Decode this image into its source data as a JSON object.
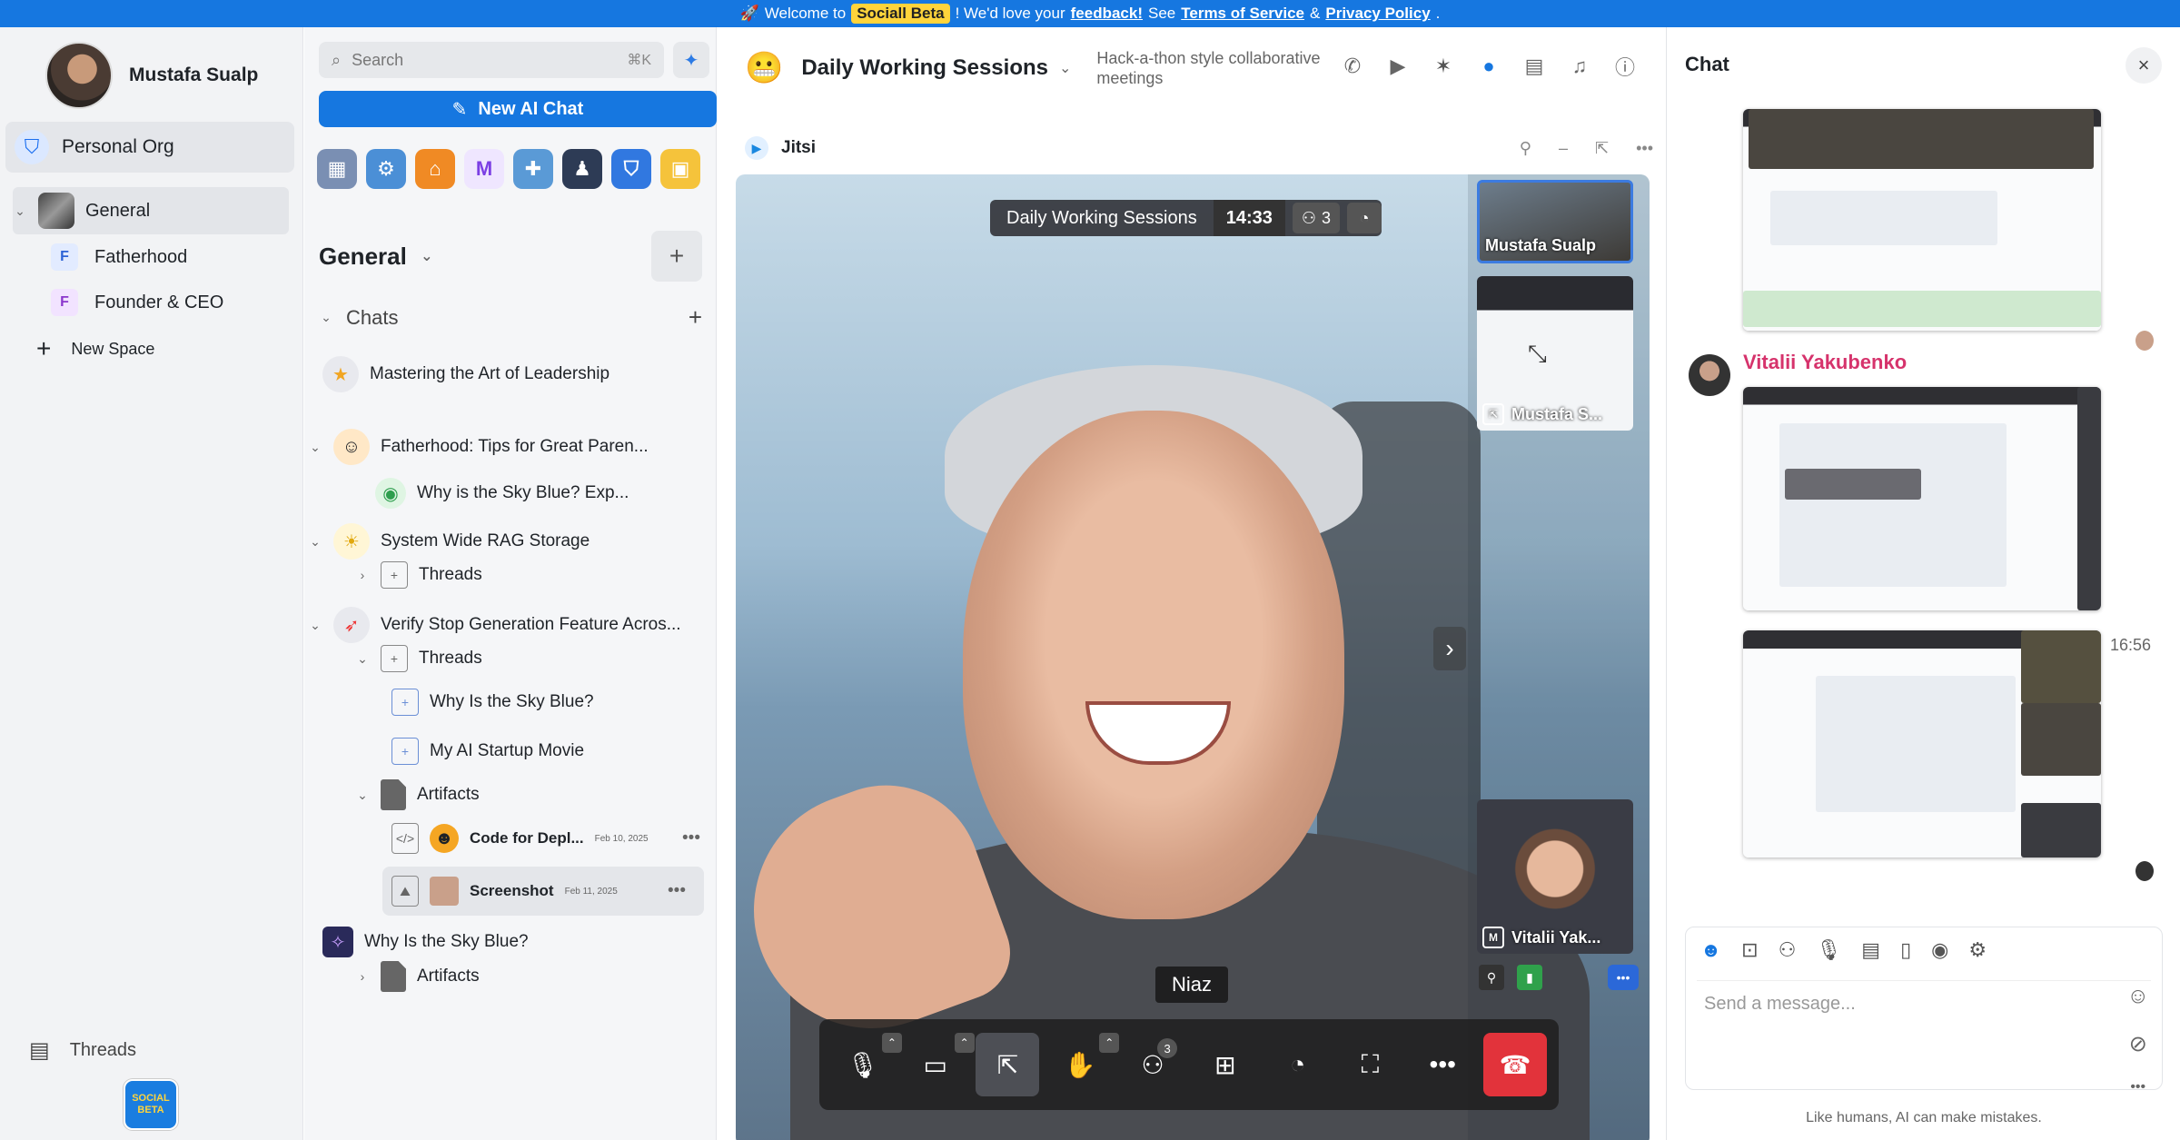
{
  "banner": {
    "icon": "🚀",
    "pre": "Welcome to",
    "badge": "Sociall Beta",
    "mid": "! We'd love your",
    "feedback": "feedback!",
    "see": "See",
    "terms": "Terms of Service",
    "amp": "&",
    "privacy": "Privacy Policy",
    "end": "."
  },
  "user": {
    "name": "Mustafa Sualp"
  },
  "org": {
    "name": "Personal Org"
  },
  "spaces": {
    "general": "General",
    "items": [
      {
        "initial": "F",
        "name": "Fatherhood"
      },
      {
        "initial": "F",
        "name": "Founder & CEO"
      }
    ],
    "new_space": "New Space"
  },
  "footer": {
    "threads": "Threads",
    "logo_top": "SOCIAL",
    "logo_bottom": "BETA"
  },
  "search": {
    "placeholder": "Search",
    "shortcut": "⌘K"
  },
  "new_ai_chat": "New AI Chat",
  "section": {
    "title": "General"
  },
  "chats": {
    "label": "Chats",
    "items": {
      "c1": "Mastering the Art of Leadership",
      "c2": "Fatherhood: Tips for Great Paren...",
      "c2sub": "Why is the Sky Blue? Exp...",
      "c3": "System Wide RAG Storage",
      "c3threads": "Threads",
      "c4": "Verify Stop Generation Feature Acros...",
      "c4threads": "Threads",
      "c4t1": "Why Is the Sky Blue?",
      "c4t2": "My AI Startup Movie",
      "c4artifacts": "Artifacts",
      "a1": "Code for Depl...",
      "a1date": "Feb 10, 2025",
      "a2": "Screenshot",
      "a2date": "Feb 11, 2025",
      "c5": "Why Is the Sky Blue?",
      "c5artifacts": "Artifacts"
    }
  },
  "header": {
    "emoji": "😬",
    "title": "Daily Working Sessions",
    "subtitle": "Hack-a-thon style collaborative meetings"
  },
  "jitsi": {
    "label": "Jitsi"
  },
  "meeting": {
    "title": "Daily Working Sessions",
    "timer": "14:33",
    "participants": "3",
    "speaker": "Niaz",
    "tiles": {
      "t1": "Mustafa Sualp",
      "t2": "Mustafa S...",
      "t3": "Vitalii Yak..."
    },
    "toolbar_badge": "3"
  },
  "chat": {
    "title": "Chat",
    "sender": "Vitalii Yakubenko",
    "time": "16:56",
    "placeholder": "Send a message...",
    "disclaimer": "Like humans, AI can make mistakes."
  },
  "colors": {
    "accent": "#1677e0",
    "end_call": "#e2333b",
    "sender": "#d6336c"
  }
}
